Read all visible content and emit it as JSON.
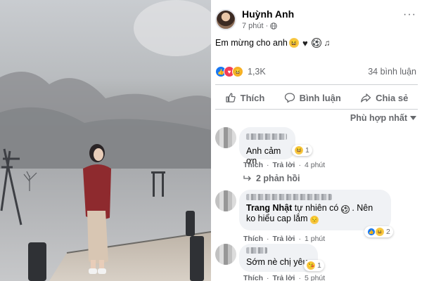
{
  "post": {
    "author": "Huỳnh Anh",
    "time": "7 phút",
    "text": "Em mừng cho anh",
    "status_emojis": [
      "grinning-face",
      "black-heart",
      "soccer-ball",
      "musical-notes"
    ],
    "reaction_count": "1,3K",
    "comment_count": "34 bình luận",
    "actions": {
      "like": "Thích",
      "comment": "Bình luận",
      "share": "Chia sẻ"
    },
    "sort_label": "Phù hợp nhất"
  },
  "comments": [
    {
      "text": "Anh cảm ơn",
      "reaction_count": "1",
      "like_label": "Thích",
      "reply_label": "Trả lời",
      "time": "4 phút",
      "replies_label": "2 phản hồi"
    },
    {
      "author": "Trang Nhật",
      "text": "tự nhiên có",
      "text_after": ". Nên ko hiểu cap lắm",
      "reaction_count": "2",
      "like_label": "Thích",
      "reply_label": "Trả lời",
      "time": "1 phút"
    },
    {
      "text": "Sớm nè chị yêu",
      "reaction_count": "1",
      "like_label": "Thích",
      "reply_label": "Trả lời",
      "time": "5 phút"
    }
  ],
  "colors": {
    "accent_blue": "#1877f2",
    "secondary_text": "#65676b",
    "bubble_bg": "#f0f2f5",
    "love_red": "#f33e58"
  }
}
